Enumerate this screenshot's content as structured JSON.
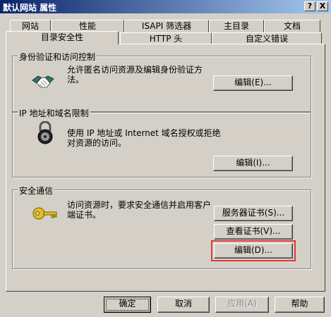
{
  "window": {
    "title": "默认网站 属性"
  },
  "titlebar_buttons": {
    "help": "?",
    "close": "X"
  },
  "tabs_back": [
    "网站",
    "性能",
    "ISAPI 筛选器",
    "主目录",
    "文档"
  ],
  "tabs_front": [
    "目录安全性",
    "HTTP 头",
    "自定义错误"
  ],
  "active_tab": "目录安全性",
  "sections": {
    "auth": {
      "label": "身份验证和访问控制",
      "text": "允许匿名访问资源及编辑身份验证方法。",
      "button": "编辑(E)..."
    },
    "ip": {
      "label": "IP 地址和域名限制",
      "text": "使用 IP 地址或 Internet 域名授权或拒绝对资源的访问。",
      "button": "编辑(I)..."
    },
    "secure": {
      "label": "安全通信",
      "text": "访问资源时，要求安全通信并启用客户端证书。",
      "buttons": [
        "服务器证书(S)...",
        "查看证书(V)...",
        "编辑(D)..."
      ]
    }
  },
  "footer_buttons": [
    "确定",
    "取消",
    "应用(A)",
    "帮助"
  ],
  "icons": [
    "handshake-icon",
    "padlock-icon",
    "key-icon"
  ],
  "colors": {
    "title_start": "#0a246a",
    "title_end": "#a6caf0",
    "highlight": "#e03a3a",
    "face": "#d4d0c8"
  }
}
